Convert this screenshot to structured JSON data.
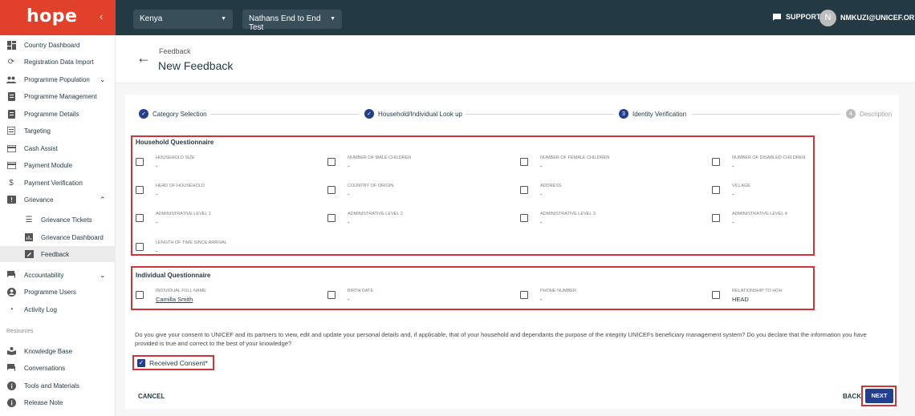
{
  "topbar": {
    "logo": "hope",
    "country": "Kenya",
    "programme": "Nathans End to End Test",
    "support": "SUPPORT",
    "avatar_initial": "N",
    "user": "NMKUZI@UNICEF.OR"
  },
  "sidebar": {
    "items": [
      {
        "label": "Country Dashboard",
        "icon": "dashboard-icon"
      },
      {
        "label": "Registration Data Import",
        "icon": "refresh-icon"
      },
      {
        "label": "Programme Population",
        "icon": "people-icon"
      },
      {
        "label": "Programme Management",
        "icon": "document-icon"
      },
      {
        "label": "Programme Details",
        "icon": "document-icon"
      },
      {
        "label": "Targeting",
        "icon": "list-icon"
      },
      {
        "label": "Cash Assist",
        "icon": "card-icon"
      },
      {
        "label": "Payment Module",
        "icon": "card-icon"
      },
      {
        "label": "Payment Verification",
        "icon": "dollar-icon"
      },
      {
        "label": "Grievance",
        "icon": "flag-icon"
      },
      {
        "label": "Grievance Tickets",
        "icon": "list-icon"
      },
      {
        "label": "Grievance Dashboard",
        "icon": "chart-icon"
      },
      {
        "label": "Feedback",
        "icon": "feedback-icon"
      },
      {
        "label": "Accountability",
        "icon": "chat-icon"
      },
      {
        "label": "Programme Users",
        "icon": "users-icon"
      },
      {
        "label": "Activity Log",
        "icon": "history-icon"
      }
    ],
    "resources_label": "Resources",
    "resources": [
      {
        "label": "Knowledge Base",
        "icon": "book-icon"
      },
      {
        "label": "Conversations",
        "icon": "chat-icon"
      },
      {
        "label": "Tools and Materials",
        "icon": "info-icon"
      },
      {
        "label": "Release Note",
        "icon": "info-icon"
      }
    ]
  },
  "header": {
    "breadcrumb": "Feedback",
    "title": "New Feedback"
  },
  "stepper": {
    "steps": [
      {
        "label": "Category Selection",
        "marker": "✓"
      },
      {
        "label": "Household/Individual Look up",
        "marker": "✓"
      },
      {
        "label": "Identity Verification",
        "marker": "3"
      },
      {
        "label": "Description",
        "marker": "4"
      }
    ]
  },
  "household": {
    "title": "Household Questionnaire",
    "fields": [
      {
        "label": "HOUSEHOLD SIZE",
        "value": "-"
      },
      {
        "label": "NUMBER OF MALE CHILDREN",
        "value": "-"
      },
      {
        "label": "NUMBER OF FEMALE CHILDREN",
        "value": "-"
      },
      {
        "label": "NUMBER OF DISABLED CHILDREN",
        "value": "-"
      },
      {
        "label": "HEAD OF HOUSEHOLD",
        "value": "-"
      },
      {
        "label": "COUNTRY OF ORIGIN",
        "value": "-"
      },
      {
        "label": "ADDRESS",
        "value": "-"
      },
      {
        "label": "VILLAGE",
        "value": "-"
      },
      {
        "label": "ADMINISTRATIVE LEVEL 1",
        "value": "-"
      },
      {
        "label": "ADMINISTRATIVE LEVEL 2",
        "value": "-"
      },
      {
        "label": "ADMINISTRATIVE LEVEL 3",
        "value": "-"
      },
      {
        "label": "ADMINISTRATIVE LEVEL 4",
        "value": "-"
      },
      {
        "label": "LENGTH OF TIME SINCE ARRIVAL",
        "value": "-"
      }
    ]
  },
  "individual": {
    "title": "Individual Questionnaire",
    "fields": [
      {
        "label": "INDIVIDUAL FULL NAME",
        "value": "Camilla Smith"
      },
      {
        "label": "BIRTH DATE",
        "value": "-"
      },
      {
        "label": "PHONE NUMBER",
        "value": "-"
      },
      {
        "label": "RELATIONSHIP TO HOH",
        "value": "HEAD"
      }
    ]
  },
  "consent": {
    "text": "Do you give your consent to UNICEF and its partners to view, edit and update your personal details and, if applicable, that of your household and dependants the purpose of the integrity UNICEFs beneficiary management system? Do you declare that the information you have provided is true and correct to the best of your knowledge?",
    "label": "Received Consent*",
    "checked": true
  },
  "actions": {
    "cancel": "CANCEL",
    "back": "BACK",
    "next": "NEXT"
  },
  "colors": {
    "topbar": "#233944",
    "brand": "#e1402b",
    "primary": "#233e8b",
    "highlight": "#d13438"
  }
}
